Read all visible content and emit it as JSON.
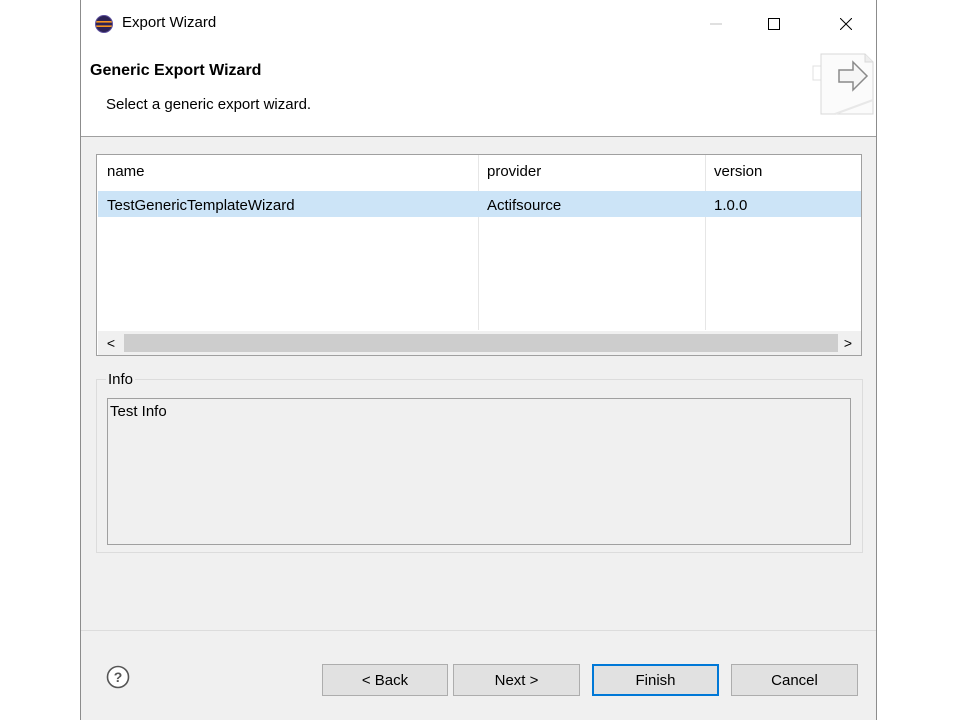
{
  "window": {
    "title": "Export Wizard",
    "icons": {
      "app": "eclipse-icon",
      "minimize": "minimize-icon",
      "maximize": "maximize-icon",
      "close": "close-icon"
    }
  },
  "header": {
    "title": "Generic Export Wizard",
    "description": "Select a generic export wizard.",
    "icon": "export-wizard-icon"
  },
  "table": {
    "columns": [
      "name",
      "provider",
      "version"
    ],
    "rows": [
      {
        "name": "TestGenericTemplateWizard",
        "provider": "Actifsource",
        "version": "1.0.0",
        "selected": true
      }
    ],
    "scroll_left": "<",
    "scroll_right": ">"
  },
  "info": {
    "label": "Info",
    "text": "Test Info"
  },
  "footer": {
    "help_icon": "help-icon",
    "buttons": {
      "back": "< Back",
      "next": "Next >",
      "finish": "Finish",
      "cancel": "Cancel"
    }
  },
  "colors": {
    "selection": "#cce4f7",
    "default_button_border": "#0078d7",
    "dialog_bg": "#f0f0f0"
  }
}
